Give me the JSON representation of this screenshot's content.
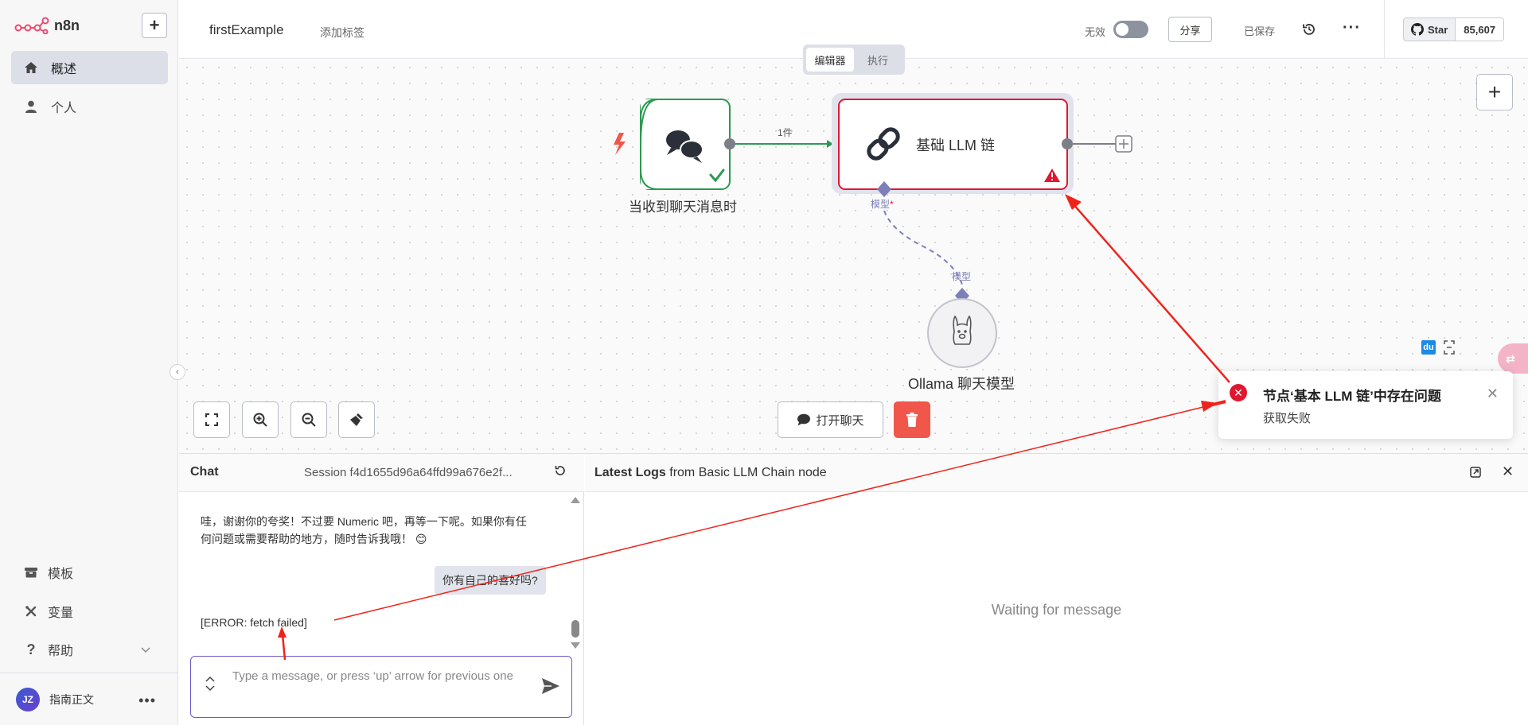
{
  "sidebar": {
    "logo_text": "n8n",
    "nav": [
      {
        "label": "概述",
        "icon": "home-icon",
        "active": true
      },
      {
        "label": "个人",
        "icon": "user-icon",
        "active": false
      }
    ],
    "bottom_nav": [
      {
        "label": "模板",
        "icon": "box-icon"
      },
      {
        "label": "变量",
        "icon": "variable-icon"
      },
      {
        "label": "帮助",
        "icon": "help-icon"
      }
    ],
    "user": {
      "initials": "JZ",
      "name": "指南正文"
    }
  },
  "header": {
    "workflow_name": "firstExample",
    "add_tag": "添加标签",
    "inactive_label": "无效",
    "share_label": "分享",
    "saved_label": "已保存",
    "github": {
      "label": "Star",
      "count": "85,607"
    }
  },
  "mode_tabs": [
    {
      "label": "编辑器",
      "active": true
    },
    {
      "label": "执行",
      "active": false
    }
  ],
  "canvas": {
    "nodes": {
      "trigger": {
        "label": "当收到聊天消息时"
      },
      "llm_chain": {
        "label": "基础 LLM 链",
        "model_port_label": "模型"
      },
      "ollama": {
        "label": "Ollama 聊天模型",
        "port_label": "模型"
      }
    },
    "connection_label": "1件",
    "open_chat_label": "打开聊天"
  },
  "toast": {
    "title": "节点‘基本 LLM 链’中存在问题",
    "message": "获取失败"
  },
  "chat": {
    "title": "Chat",
    "session": "Session  f4d1655d96a64ffd99a676e2f...",
    "messages": {
      "bot": "哇，谢谢你的夸奖！不过要 Numeric 吧，再等一下呢。如果你有任何问题或需要帮助的地方，随时告诉我哦！ 😊",
      "user": "你有自己的喜好吗?",
      "error": "[ERROR: fetch failed]"
    },
    "input_placeholder": "Type a message, or press ‘up’ arrow for previous one"
  },
  "logs": {
    "title_bold": "Latest Logs",
    "title_rest": " from Basic LLM Chain node",
    "waiting": "Waiting for message"
  },
  "colors": {
    "accent": "#6a5acd",
    "error": "#e0172f",
    "success": "#2b9a52",
    "delete": "#f0564a",
    "connection": "#7e7fb8"
  }
}
